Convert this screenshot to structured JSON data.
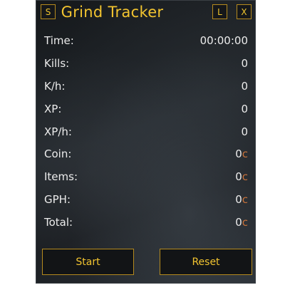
{
  "window": {
    "title": "Grind Tracker",
    "btn_s": "S",
    "btn_l": "L",
    "btn_x": "X"
  },
  "stats": [
    {
      "label": "Time:",
      "value": "00:00:00",
      "suffix": ""
    },
    {
      "label": "Kills:",
      "value": "0",
      "suffix": ""
    },
    {
      "label": "K/h:",
      "value": "0",
      "suffix": ""
    },
    {
      "label": "XP:",
      "value": "0",
      "suffix": ""
    },
    {
      "label": "XP/h:",
      "value": "0",
      "suffix": ""
    },
    {
      "label": "Coin:",
      "value": "0",
      "suffix": "c"
    },
    {
      "label": "Items:",
      "value": "0",
      "suffix": "c"
    },
    {
      "label": "GPH:",
      "value": "0",
      "suffix": "c"
    },
    {
      "label": "Total:",
      "value": "0",
      "suffix": "c"
    }
  ],
  "actions": {
    "start_label": "Start",
    "reset_label": "Reset"
  },
  "colors": {
    "accent_gold": "#f2c430",
    "copper": "#c8723a",
    "text": "#ececec"
  }
}
